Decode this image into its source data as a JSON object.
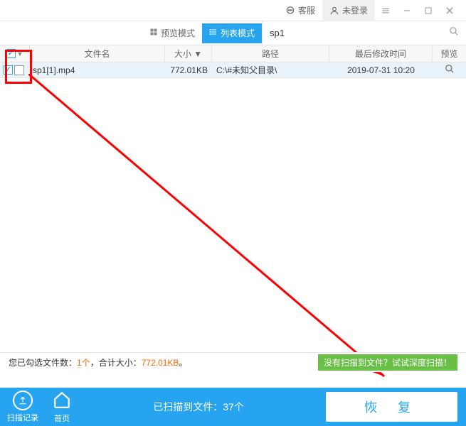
{
  "titlebar": {
    "service_label": "客服",
    "login_label": "未登录"
  },
  "toolbar": {
    "preview_mode": "预览模式",
    "list_mode": "列表模式",
    "search_value": "sp1"
  },
  "table": {
    "headers": {
      "filename": "文件名",
      "size": "大小 ▼",
      "path": "路径",
      "time": "最后修改时间",
      "preview": "预览"
    },
    "rows": [
      {
        "filename": "sp1[1].mp4",
        "size": "772.01KB",
        "path": "C:\\#未知父目录\\",
        "time": "2019-07-31  10:20"
      }
    ]
  },
  "status": {
    "prefix": "您已勾选文件数：",
    "count": "1个",
    "mid": "，合计大小：",
    "size": "772.01KB",
    "suffix": "。"
  },
  "deep_scan_tip": "没有扫描到文件？试试深度扫描！",
  "bottom": {
    "scan_record": "扫描记录",
    "home": "首页",
    "scan_status": "已扫描到文件：37个",
    "recover": "恢 复"
  }
}
